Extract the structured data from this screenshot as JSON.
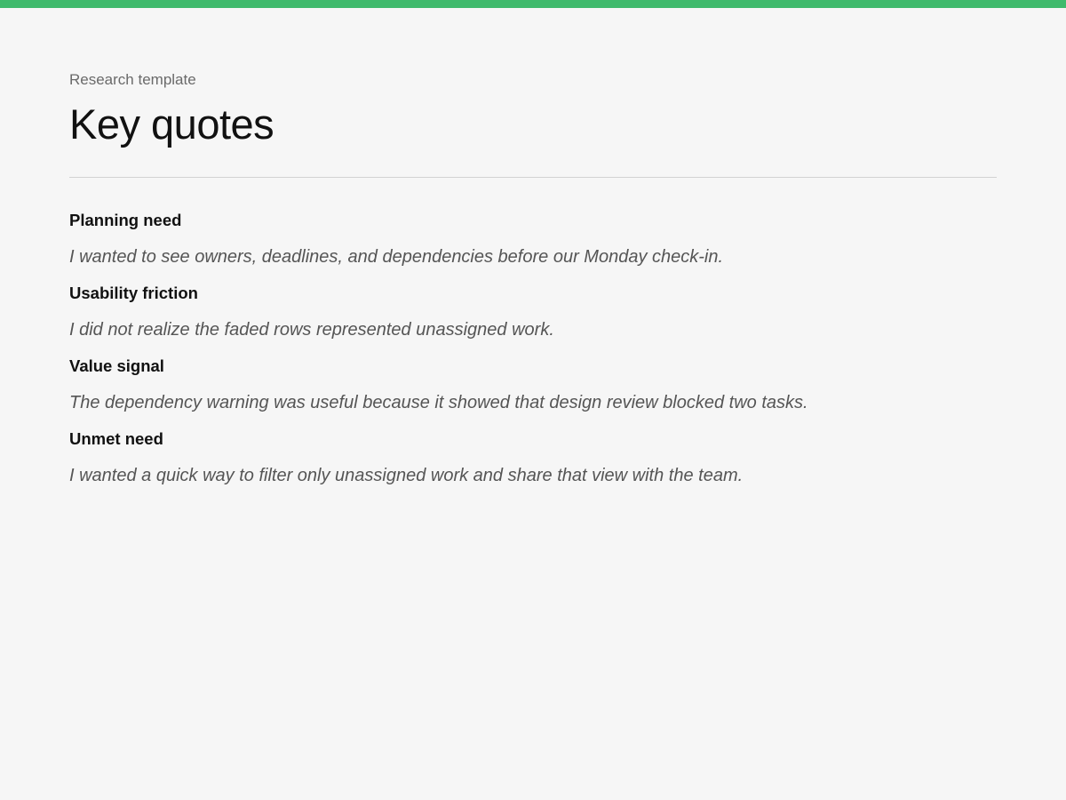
{
  "accent_color": "#3fba6c",
  "header": {
    "eyebrow": "Research template",
    "title": "Key quotes"
  },
  "quotes": [
    {
      "heading": "Planning need",
      "text": "I wanted to see owners, deadlines, and dependencies before our Monday check-in."
    },
    {
      "heading": "Usability friction",
      "text": "I did not realize the faded rows represented unassigned work."
    },
    {
      "heading": "Value signal",
      "text": "The dependency warning was useful because it showed that design review blocked two tasks."
    },
    {
      "heading": "Unmet need",
      "text": "I wanted a quick way to filter only unassigned work and share that view with the team."
    }
  ]
}
